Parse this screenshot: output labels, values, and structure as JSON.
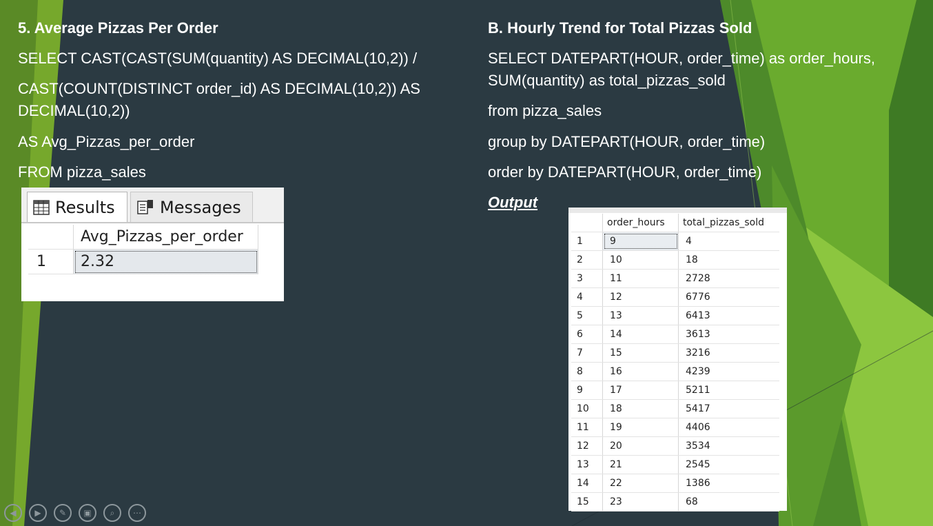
{
  "colors": {
    "background": "#2b3a42",
    "accent_green": "#7ab52a",
    "text": "#ffffff"
  },
  "left": {
    "heading": "5. Average Pizzas Per Order",
    "lines": [
      "SELECT CAST(CAST(SUM(quantity) AS DECIMAL(10,2)) /",
      "CAST(COUNT(DISTINCT order_id) AS DECIMAL(10,2)) AS",
      "DECIMAL(10,2))",
      "AS Avg_Pizzas_per_order",
      "FROM pizza_sales"
    ],
    "results_panel": {
      "tab_results": "Results",
      "tab_messages": "Messages",
      "column_header": "Avg_Pizzas_per_order",
      "row_number": "1",
      "value": "2.32"
    }
  },
  "right": {
    "heading": "B. Hourly Trend for Total Pizzas Sold",
    "lines": [
      "SELECT DATEPART(HOUR, order_time) as order_hours,",
      "SUM(quantity) as total_pizzas_sold",
      "from pizza_sales",
      "group by DATEPART(HOUR, order_time)",
      "order by DATEPART(HOUR, order_time)"
    ],
    "output_label": "Output",
    "results_table": {
      "headers": [
        "order_hours",
        "total_pizzas_sold"
      ],
      "rows": [
        [
          "1",
          "9",
          "4"
        ],
        [
          "2",
          "10",
          "18"
        ],
        [
          "3",
          "11",
          "2728"
        ],
        [
          "4",
          "12",
          "6776"
        ],
        [
          "5",
          "13",
          "6413"
        ],
        [
          "6",
          "14",
          "3613"
        ],
        [
          "7",
          "15",
          "3216"
        ],
        [
          "8",
          "16",
          "4239"
        ],
        [
          "9",
          "17",
          "5211"
        ],
        [
          "10",
          "18",
          "5417"
        ],
        [
          "11",
          "19",
          "4406"
        ],
        [
          "12",
          "20",
          "3534"
        ],
        [
          "13",
          "21",
          "2545"
        ],
        [
          "14",
          "22",
          "1386"
        ],
        [
          "15",
          "23",
          "68"
        ]
      ]
    }
  },
  "nav_icons": [
    "previous-icon",
    "next-icon",
    "pen-icon",
    "slides-icon",
    "zoom-icon",
    "more-icon"
  ]
}
